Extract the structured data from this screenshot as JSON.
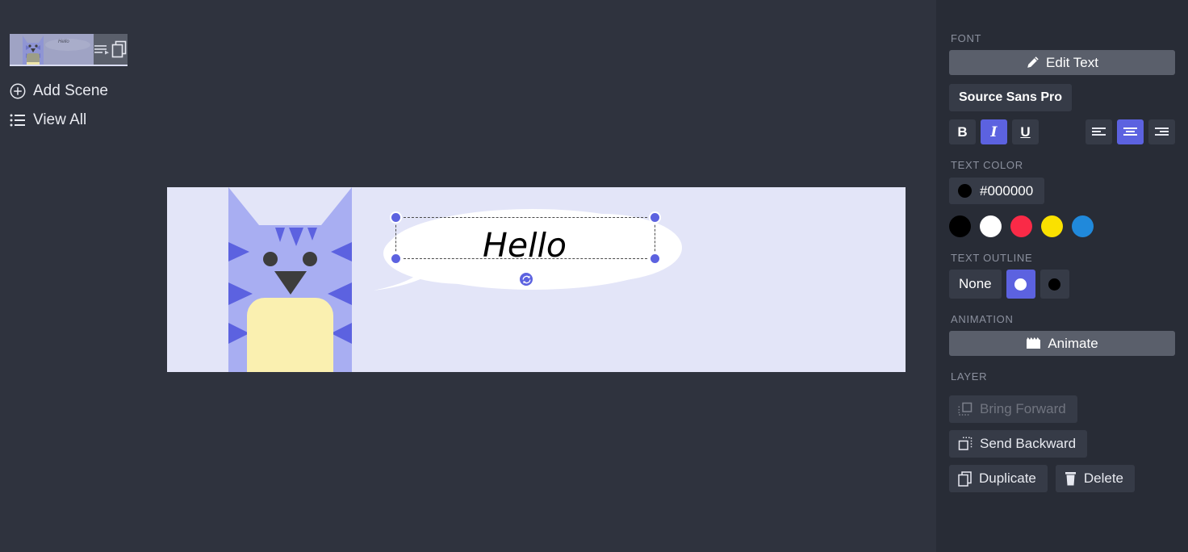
{
  "theme": {
    "app_bg": "#2f333e",
    "panel_bg": "#282c36",
    "accent": "#5c62e0",
    "button_bg": "#363b47",
    "button_bg_light": "#5a5f6b",
    "canvas_bg": "#e3e5f8",
    "label_color": "#8b909e"
  },
  "scene_strip": {
    "thumbnail": {
      "name": "scene-1",
      "preview_text": "Hello",
      "icons": [
        "captions-icon",
        "duplicate-icon"
      ]
    },
    "add_scene_label": "Add Scene",
    "view_all_label": "View All"
  },
  "canvas": {
    "text_object": {
      "value": "Hello",
      "font_style": "italic",
      "color": "#000000",
      "align": "center"
    },
    "bubble": {
      "fill": "#ffffff"
    },
    "character": {
      "name": "cat",
      "fur_color": "#a8aef2",
      "stripe_color": "#5c62e0",
      "chest_color": "#faf0b0",
      "face_color": "#3d3d3d"
    },
    "selection": {
      "handles": 4,
      "rotate_icon": "rotate-icon"
    }
  },
  "panel": {
    "font_section": {
      "label": "FONT",
      "edit_text_label": "Edit Text",
      "edit_text_icon": "pencil-icon",
      "font_family_value": "Source Sans Pro",
      "bold_label": "B",
      "italic_label": "I",
      "underline_label": "U",
      "bold_active": false,
      "italic_active": true,
      "underline_active": false,
      "align_options": [
        "align-left-icon",
        "align-center-icon",
        "align-right-icon"
      ],
      "align_selected": "align-center-icon"
    },
    "text_color_section": {
      "label": "TEXT COLOR",
      "current_value": "#000000",
      "swatches": [
        "#000000",
        "#ffffff",
        "#fa2a47",
        "#fae100",
        "#2089db"
      ]
    },
    "text_outline_section": {
      "label": "TEXT OUTLINE",
      "none_label": "None",
      "options": [
        "#ffffff",
        "#000000"
      ],
      "selected": "#ffffff"
    },
    "animation_section": {
      "label": "ANIMATION",
      "animate_label": "Animate",
      "animate_icon": "clapperboard-icon"
    },
    "layer_section": {
      "label": "LAYER",
      "bring_forward_label": "Bring Forward",
      "bring_forward_icon": "bring-forward-icon",
      "bring_forward_disabled": true,
      "send_backward_label": "Send Backward",
      "send_backward_icon": "send-backward-icon",
      "duplicate_label": "Duplicate",
      "duplicate_icon": "duplicate-icon",
      "delete_label": "Delete",
      "delete_icon": "trash-icon"
    }
  }
}
